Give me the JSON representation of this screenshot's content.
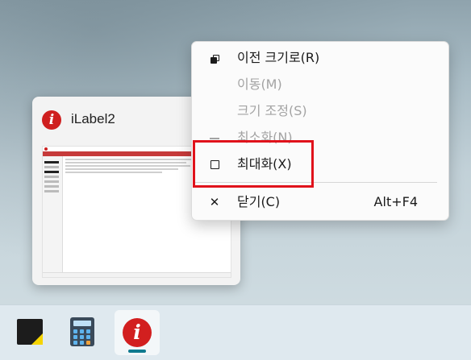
{
  "thumbnail": {
    "app_icon": "ilabel-app-icon",
    "title": "iLabel2"
  },
  "context_menu": {
    "items": [
      {
        "label": "이전 크기로(R)",
        "icon": "restore-icon",
        "enabled": true
      },
      {
        "label": "이동(M)",
        "icon": "",
        "enabled": false
      },
      {
        "label": "크기 조정(S)",
        "icon": "",
        "enabled": false
      },
      {
        "label": "최소화(N)",
        "icon": "minimize-icon",
        "enabled": false
      },
      {
        "label": "최대화(X)",
        "icon": "maximize-icon",
        "enabled": true,
        "highlighted": true
      },
      {
        "label": "닫기(C)",
        "icon": "close-icon",
        "enabled": true,
        "accelerator": "Alt+F4"
      }
    ],
    "close_glyph": "✕",
    "highlight_color": "#e0121b"
  },
  "taskbar": {
    "apps": [
      {
        "name": "sticky-notes-icon",
        "active": false
      },
      {
        "name": "calculator-icon",
        "active": false
      },
      {
        "name": "ilabel-app-icon",
        "active": true
      }
    ],
    "indicator_color": "#0f7a8f"
  },
  "icon_letter": "i"
}
